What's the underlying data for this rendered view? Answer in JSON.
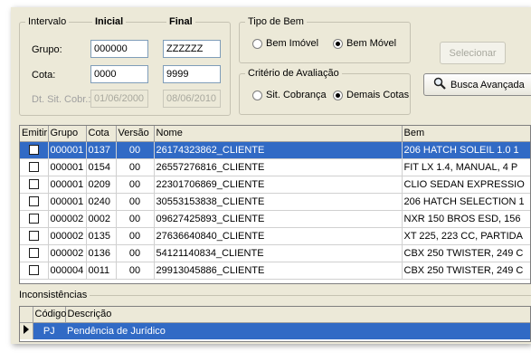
{
  "filters": {
    "group_title": "Intervalo",
    "inicial_header": "Inicial",
    "final_header": "Final",
    "grupo_label": "Grupo:",
    "grupo_inicial": "000000",
    "grupo_final": "ZZZZZZ",
    "cota_label": "Cota:",
    "cota_inicial": "0000",
    "cota_final": "9999",
    "dt_label": "Dt. Sit. Cobr.:",
    "dt_inicial": "01/06/2000",
    "dt_final": "08/06/2010"
  },
  "tipo_bem": {
    "title": "Tipo de Bem",
    "opt_imovel": "Bem Imóvel",
    "opt_movel": "Bem Móvel",
    "selected": "Bem Móvel"
  },
  "criterio": {
    "title": "Critério de Avaliação",
    "opt_cobranca": "Sit. Cobrança",
    "opt_demais": "Demais Cotas",
    "selected": "Demais Cotas"
  },
  "buttons": {
    "selecionar": "Selecionar",
    "busca": "Busca Avançada"
  },
  "grid": {
    "columns": [
      "Emitir",
      "Grupo",
      "Cota",
      "Versão",
      "Nome",
      "Bem"
    ],
    "rows": [
      {
        "grupo": "000001",
        "cota": "0137",
        "versao": "00",
        "nome": "26174323862_CLIENTE",
        "bem": "206 HATCH SOLEIL 1.0 1"
      },
      {
        "grupo": "000001",
        "cota": "0154",
        "versao": "00",
        "nome": "26557276816_CLIENTE",
        "bem": "FIT LX 1.4, MANUAL, 4 P"
      },
      {
        "grupo": "000001",
        "cota": "0209",
        "versao": "00",
        "nome": "22301706869_CLIENTE",
        "bem": "CLIO SEDAN EXPRESSIO"
      },
      {
        "grupo": "000001",
        "cota": "0240",
        "versao": "00",
        "nome": "30553153838_CLIENTE",
        "bem": "206 HATCH SELECTION 1"
      },
      {
        "grupo": "000002",
        "cota": "0002",
        "versao": "00",
        "nome": "09627425893_CLIENTE",
        "bem": "NXR 150 BROS ESD, 156"
      },
      {
        "grupo": "000002",
        "cota": "0135",
        "versao": "00",
        "nome": "27636640840_CLIENTE",
        "bem": "XT 225, 223 CC, PARTIDA"
      },
      {
        "grupo": "000002",
        "cota": "0136",
        "versao": "00",
        "nome": "54121140834_CLIENTE",
        "bem": "CBX 250 TWISTER, 249 C"
      },
      {
        "grupo": "000004",
        "cota": "0011",
        "versao": "00",
        "nome": "29913045886_CLIENTE",
        "bem": "CBX 250 TWISTER, 249 C"
      }
    ]
  },
  "inconsistencias": {
    "title": "Inconsistências",
    "columns": [
      "Código",
      "Descrição"
    ],
    "rows": [
      {
        "codigo": "PJ",
        "descricao": "Pendência de Jurídico"
      }
    ]
  },
  "colors": {
    "selection": "#316ac5",
    "face": "#ece9d8"
  }
}
